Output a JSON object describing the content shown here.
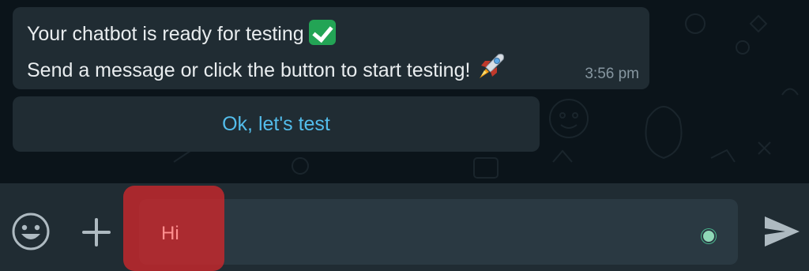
{
  "message": {
    "line1": "Your chatbot is ready for testing",
    "line1_emoji": "check-mark-button-icon",
    "line2": "Send a message or click the button to start testing!",
    "line2_emoji": "rocket-icon",
    "time": "3:56 pm"
  },
  "quick_reply": {
    "label": "Ok, let's test"
  },
  "composer": {
    "value": "Hi",
    "emoji_icon": "emoji-icon",
    "attach_icon": "plus-icon",
    "send_icon": "send-icon"
  },
  "colors": {
    "background": "#0b141a",
    "bubble": "#202c33",
    "input_bar": "#202c33",
    "input_field": "#2a3942",
    "link_blue": "#53bdeb",
    "text_primary": "#e9edef",
    "text_secondary": "#8696a0",
    "highlight_red": "#d0282c"
  }
}
